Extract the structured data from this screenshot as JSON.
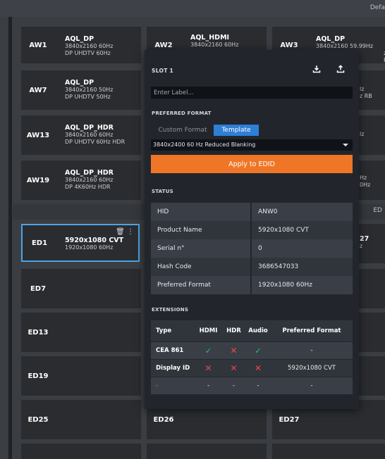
{
  "header": {
    "default_label": "Defa"
  },
  "tiles": {
    "aw1": {
      "code": "AW1",
      "name": "AQL_DP",
      "line1": "3840x2160 60Hz",
      "line2": "DP UHDTV 60Hz"
    },
    "aw2": {
      "code": "AW2",
      "name": "AQL_HDMI",
      "line1": "3840x2160 60Hz"
    },
    "aw3": {
      "code": "AW3",
      "name": "AQL_DP",
      "line1": "3840x2160 59.99Hz",
      "line2": "z RB"
    },
    "aw7": {
      "code": "AW7",
      "name": "AQL_DP",
      "line1": "3840x2160 50Hz",
      "line2": "DP UHDTV 50Hz"
    },
    "aw9_partial": {
      "line1": "lz",
      "line2": "z RB"
    },
    "aw13": {
      "code": "AW13",
      "name": "AQL_DP_HDR",
      "line1": "3840x2160 60Hz",
      "line2": "DP UHDTV 60Hz HDR"
    },
    "aw15_partial": {
      "line1": "lz"
    },
    "aw19": {
      "code": "AW19",
      "name": "AQL_DP_HDR",
      "line1": "3840x2160 60Hz",
      "line2": "DP 4K60Hz HDR"
    },
    "aw21_partial": {
      "line1": "Hz",
      "line2": "0Hz"
    },
    "ed1": {
      "code": "ED1",
      "name": "5920x1080 CVT",
      "line1": "1920x1080 60Hz",
      "trash_icon": "trash-icon",
      "more_icon": "more-vertical-icon"
    },
    "ed3_partial": {
      "name": "27",
      "line1": "z"
    },
    "ed7": {
      "code": "ED7"
    },
    "ed13": {
      "code": "ED13"
    },
    "ed19": {
      "code": "ED19"
    },
    "ed25": {
      "code": "ED25"
    },
    "ed26": {
      "code": "ED26"
    },
    "ed27": {
      "code": "ED27"
    }
  },
  "section_label": "ED",
  "panel": {
    "slot_title": "SLOT 1",
    "download_icon": "download-icon",
    "upload_icon": "upload-icon",
    "label_placeholder": "Enter Label...",
    "preferred_format_title": "PREFERRED FORMAT",
    "tabs": {
      "custom": "Custom Format",
      "template": "Template"
    },
    "selected_format": "3840x2400 60 Hz Reduced Blanking",
    "apply_button": "Apply to EDID",
    "status_title": "STATUS",
    "status": [
      {
        "key": "HID",
        "value": "ANW0"
      },
      {
        "key": "Product Name",
        "value": "5920x1080 CVT"
      },
      {
        "key": "Serial n°",
        "value": "0"
      },
      {
        "key": "Hash Code",
        "value": "3686547033"
      },
      {
        "key": "Preferred Format",
        "value": "1920x1080 60Hz"
      }
    ],
    "extensions_title": "EXTENSIONS",
    "extensions_headers": {
      "type": "Type",
      "hdmi": "HDMI",
      "hdr": "HDR",
      "audio": "Audio",
      "pf": "Preferred Format"
    },
    "extensions": [
      {
        "type": "CEA 861",
        "hdmi": "check",
        "hdr": "cross",
        "audio": "check",
        "pf": "-"
      },
      {
        "type": "Display ID",
        "hdmi": "cross",
        "hdr": "cross",
        "audio": "cross",
        "pf": "5920x1080 CVT"
      },
      {
        "type": "-",
        "hdmi": "-",
        "hdr": "-",
        "audio": "-",
        "pf": "-"
      }
    ],
    "colors": {
      "accent": "#2e7fd6",
      "apply": "#ef7626",
      "check": "#28c76f",
      "cross": "#ee4444",
      "selected_border": "#4ea3e6"
    }
  }
}
